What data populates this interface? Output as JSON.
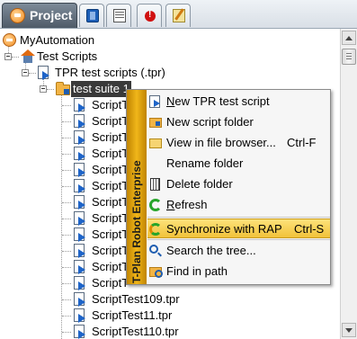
{
  "tabs": [
    {
      "label": "Project",
      "icon": "project-icon",
      "active": true
    },
    {
      "label": "",
      "icon": "book-icon"
    },
    {
      "label": "",
      "icon": "table-icon"
    },
    {
      "label": "",
      "icon": "error-icon"
    },
    {
      "label": "",
      "icon": "edit-icon"
    }
  ],
  "tree": {
    "root": "MyAutomation",
    "test_scripts": "Test Scripts",
    "tpr_scripts": "TPR test scripts (.tpr)",
    "suite": "test suite 1",
    "partial_label": "ScriptT",
    "partial_count": 13,
    "bottom_items": [
      "ScriptTest109.tpr",
      "ScriptTest11.tpr",
      "ScriptTest110.tpr"
    ]
  },
  "context_menu": {
    "brand": "T-Plan Robot Enterprise",
    "new_script_pre": "",
    "new_script_u": "N",
    "new_script_post": "ew TPR test script",
    "new_folder": "New script folder",
    "view_browser": "View in file browser...",
    "view_browser_shortcut": "Ctrl-F",
    "rename": "Rename folder",
    "delete": "Delete folder",
    "refresh_u": "R",
    "refresh_post": "efresh",
    "synchronize": "Synchronize with RAP",
    "synchronize_shortcut": "Ctrl-S",
    "search": "Search the tree...",
    "find_in_path": "Find in path"
  },
  "colors": {
    "highlight": "#f1c23a",
    "brand_strip": "#f0b61a",
    "selection": "#3a3a3a"
  }
}
